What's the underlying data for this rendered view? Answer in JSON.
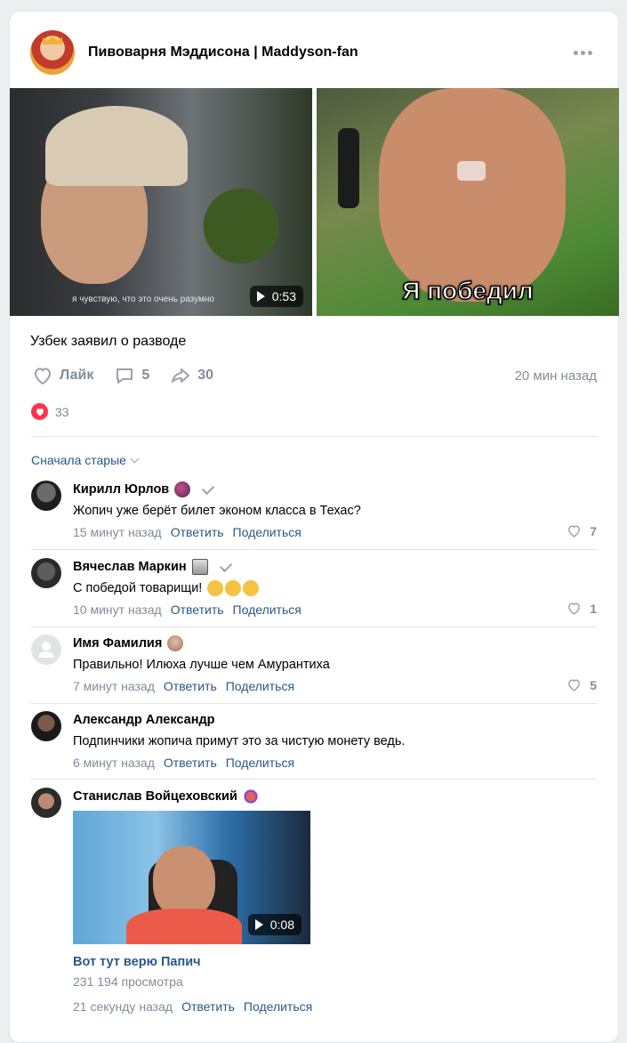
{
  "post": {
    "group_name": "Пивоварня Мэддисона | Maddyson-fan",
    "video_subtitle": "я чувствую, что это очень разумно",
    "video_duration": "0:53",
    "meme_caption": "Я победил",
    "text": "Узбек заявил о разводе",
    "like_label": "Лайк",
    "comments_count": "5",
    "shares_count": "30",
    "time": "20 мин назад",
    "reactions_count": "33"
  },
  "sort_label": "Сначала старые",
  "colors": {
    "link": "#2a5885",
    "muted": "#818c99",
    "reaction": "#ff3347"
  },
  "comments": [
    {
      "name": "Кирилл Юрлов",
      "text": "Жопич уже берёт билет эконом класса в Техас?",
      "time": "15 минут назад",
      "reply": "Ответить",
      "share": "Поделиться",
      "likes": "7"
    },
    {
      "name": "Вячеслав Маркин",
      "text": "С победой товарищи!",
      "time": "10 минут назад",
      "reply": "Ответить",
      "share": "Поделиться",
      "likes": "1"
    },
    {
      "name": "Имя Фамилия",
      "text": "Правильно! Илюха лучше чем Амурантиха",
      "time": "7 минут назад",
      "reply": "Ответить",
      "share": "Поделиться",
      "likes": "5"
    },
    {
      "name": "Александр Александр",
      "text": "Подпинчики жопича примут это за чистую монету ведь.",
      "time": "6 минут назад",
      "reply": "Ответить",
      "share": "Поделиться"
    },
    {
      "name": "Станислав Войцеховский",
      "video_duration": "0:08",
      "video_title": "Вот тут верю Папич",
      "video_views": "231 194 просмотра",
      "time": "21 секунду назад",
      "reply": "Ответить",
      "share": "Поделиться"
    }
  ]
}
